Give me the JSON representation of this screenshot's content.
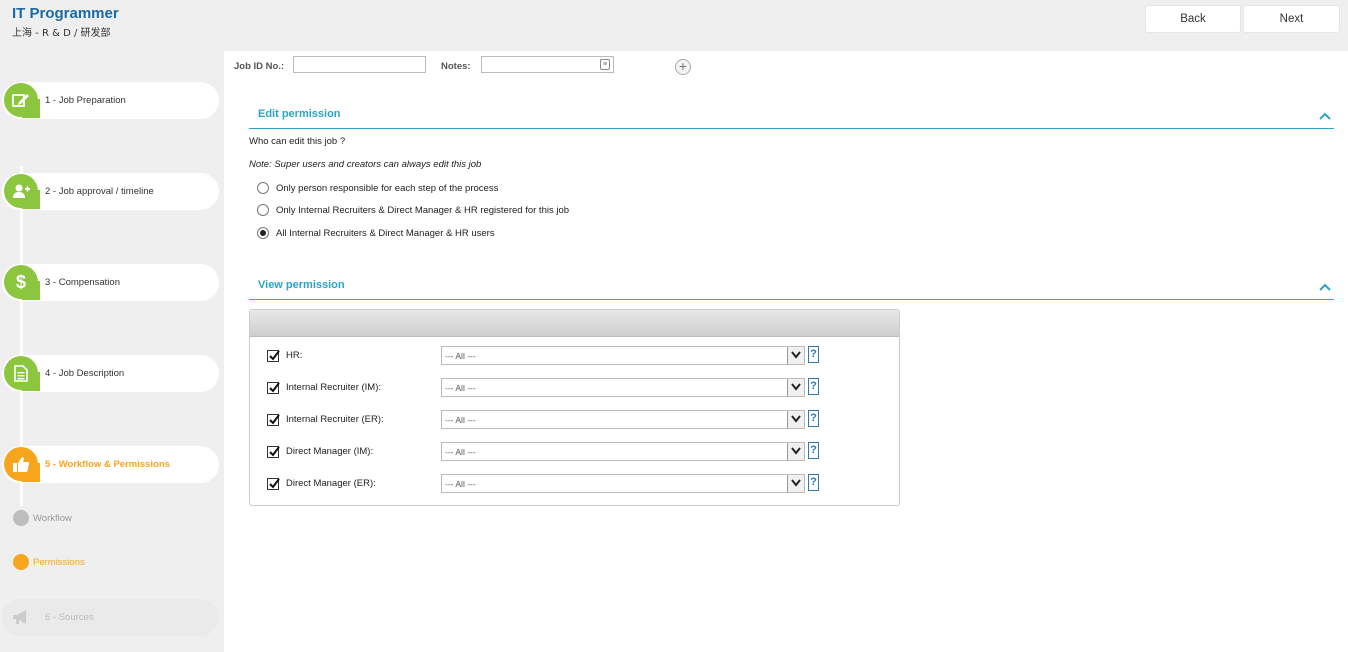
{
  "header": {
    "job_title": "IT Programmer",
    "job_subtitle": "上海 - R & D / 研发部",
    "back_label": "Back",
    "next_label": "Next"
  },
  "sidebar": {
    "steps": [
      {
        "label": "1 - Job Preparation",
        "icon": "edit-icon",
        "state": "done"
      },
      {
        "label": "2 - Job approval / timeline",
        "icon": "add-user-icon",
        "state": "done"
      },
      {
        "label": "3 - Compensation",
        "icon": "dollar-icon",
        "state": "done"
      },
      {
        "label": "4 - Job Description",
        "icon": "document-icon",
        "state": "done"
      },
      {
        "label": "5 - Workflow & Permissions",
        "icon": "thumbs-up-icon",
        "state": "active"
      },
      {
        "label": "6 - Sources",
        "icon": "megaphone-icon",
        "state": "disabled"
      }
    ],
    "substeps": [
      {
        "label": "Workflow",
        "state": "inactive"
      },
      {
        "label": "Permissions",
        "state": "active"
      }
    ]
  },
  "form": {
    "job_id_label": "Job ID No.:",
    "job_id_value": "",
    "notes_label": "Notes:",
    "notes_value": ""
  },
  "edit_permission": {
    "title": "Edit permission",
    "question": "Who can edit this job ?",
    "note": "Note: Super users and creators can always edit this job",
    "options": [
      {
        "label": "Only person responsible for each step of the process",
        "selected": false
      },
      {
        "label": "Only Internal Recruiters & Direct Manager & HR registered for this job",
        "selected": false
      },
      {
        "label": "All Internal Recruiters & Direct Manager & HR users",
        "selected": true
      }
    ]
  },
  "view_permission": {
    "title": "View permission",
    "rows": [
      {
        "label": "HR:",
        "checked": true,
        "value": "--- All ---",
        "help": "?"
      },
      {
        "label": "Internal Recruiter (IM):",
        "checked": true,
        "value": "--- All ---",
        "help": "?"
      },
      {
        "label": "Internal Recruiter (ER):",
        "checked": true,
        "value": "--- All ---",
        "help": "?"
      },
      {
        "label": "Direct Manager (IM):",
        "checked": true,
        "value": "--- All ---",
        "help": "?"
      },
      {
        "label": "Direct Manager (ER):",
        "checked": true,
        "value": "--- All ---",
        "help": "?"
      }
    ]
  },
  "colors": {
    "accent_green": "#8cc63f",
    "accent_orange": "#f7a51c",
    "accent_blue": "#2aa4c8",
    "title_blue": "#1a6aa5"
  }
}
